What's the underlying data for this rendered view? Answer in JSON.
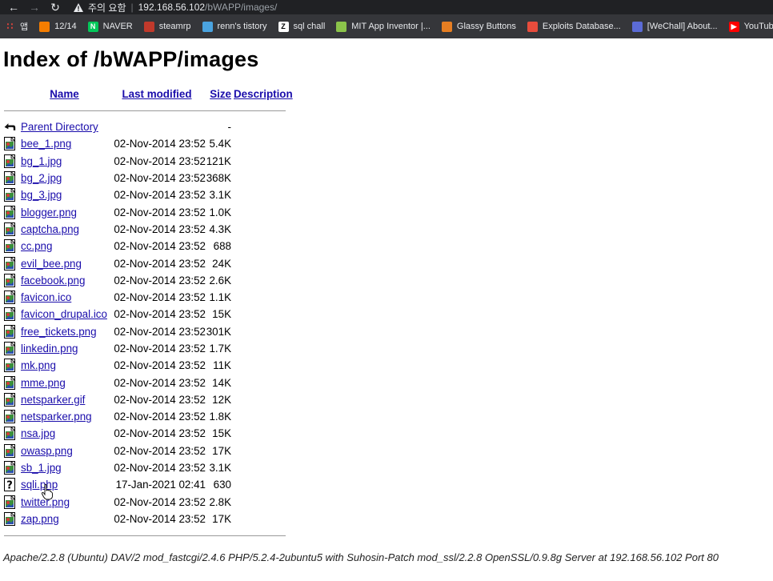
{
  "browser": {
    "security_label": "주의 요함",
    "url_host": "192.168.56.102",
    "url_path": "/bWAPP/images/",
    "bookmarks": [
      {
        "label": "앱",
        "icon": "apps-grid-icon",
        "color": "#e8453c"
      },
      {
        "label": "12/14",
        "icon": "blogger-icon",
        "color": "#f57d00"
      },
      {
        "label": "NAVER",
        "icon": "naver-icon",
        "color": "#03c75a"
      },
      {
        "label": "steamrp",
        "icon": "steamrp-icon",
        "color": "#c0392b"
      },
      {
        "label": "renn's tistory",
        "icon": "tistory-icon",
        "color": "#4aa3df"
      },
      {
        "label": "sql chall",
        "icon": "z-icon",
        "color": "#ffffff"
      },
      {
        "label": "MIT App Inventor |...",
        "icon": "mit-app-inventor-icon",
        "color": "#8bc34a"
      },
      {
        "label": "Glassy Buttons",
        "icon": "glassy-buttons-icon",
        "color": "#e67e22"
      },
      {
        "label": "Exploits Database...",
        "icon": "exploit-db-icon",
        "color": "#e74c3c"
      },
      {
        "label": "[WeChall] About...",
        "icon": "wechall-icon",
        "color": "#5b6bd6"
      },
      {
        "label": "YouTube",
        "icon": "youtube-icon",
        "color": "#ff0000"
      }
    ]
  },
  "page": {
    "title": "Index of /bWAPP/images",
    "columns": {
      "name": "Name",
      "last_modified": "Last modified",
      "size": "Size",
      "description": "Description"
    },
    "parent": {
      "name": "Parent Directory",
      "size": "-"
    },
    "files": [
      {
        "name": "bee_1.png",
        "date": "02-Nov-2014 23:52",
        "size": "5.4K",
        "icon": "image-file-icon"
      },
      {
        "name": "bg_1.jpg",
        "date": "02-Nov-2014 23:52",
        "size": "121K",
        "icon": "image-file-icon"
      },
      {
        "name": "bg_2.jpg",
        "date": "02-Nov-2014 23:52",
        "size": "368K",
        "icon": "image-file-icon"
      },
      {
        "name": "bg_3.jpg",
        "date": "02-Nov-2014 23:52",
        "size": "3.1K",
        "icon": "image-file-icon"
      },
      {
        "name": "blogger.png",
        "date": "02-Nov-2014 23:52",
        "size": "1.0K",
        "icon": "image-file-icon"
      },
      {
        "name": "captcha.png",
        "date": "02-Nov-2014 23:52",
        "size": "4.3K",
        "icon": "image-file-icon"
      },
      {
        "name": "cc.png",
        "date": "02-Nov-2014 23:52",
        "size": "688",
        "icon": "image-file-icon"
      },
      {
        "name": "evil_bee.png",
        "date": "02-Nov-2014 23:52",
        "size": "24K",
        "icon": "image-file-icon"
      },
      {
        "name": "facebook.png",
        "date": "02-Nov-2014 23:52",
        "size": "2.6K",
        "icon": "image-file-icon"
      },
      {
        "name": "favicon.ico",
        "date": "02-Nov-2014 23:52",
        "size": "1.1K",
        "icon": "image-file-icon"
      },
      {
        "name": "favicon_drupal.ico",
        "date": "02-Nov-2014 23:52",
        "size": "15K",
        "icon": "image-file-icon"
      },
      {
        "name": "free_tickets.png",
        "date": "02-Nov-2014 23:52",
        "size": "301K",
        "icon": "image-file-icon"
      },
      {
        "name": "linkedin.png",
        "date": "02-Nov-2014 23:52",
        "size": "1.7K",
        "icon": "image-file-icon"
      },
      {
        "name": "mk.png",
        "date": "02-Nov-2014 23:52",
        "size": "11K",
        "icon": "image-file-icon"
      },
      {
        "name": "mme.png",
        "date": "02-Nov-2014 23:52",
        "size": "14K",
        "icon": "image-file-icon"
      },
      {
        "name": "netsparker.gif",
        "date": "02-Nov-2014 23:52",
        "size": "12K",
        "icon": "image-file-icon"
      },
      {
        "name": "netsparker.png",
        "date": "02-Nov-2014 23:52",
        "size": "1.8K",
        "icon": "image-file-icon"
      },
      {
        "name": "nsa.jpg",
        "date": "02-Nov-2014 23:52",
        "size": "15K",
        "icon": "image-file-icon"
      },
      {
        "name": "owasp.png",
        "date": "02-Nov-2014 23:52",
        "size": "17K",
        "icon": "image-file-icon"
      },
      {
        "name": "sb_1.jpg",
        "date": "02-Nov-2014 23:52",
        "size": "3.1K",
        "icon": "image-file-icon"
      },
      {
        "name": "sqli.php",
        "date": "17-Jan-2021 02:41",
        "size": "630",
        "icon": "unknown-file-icon"
      },
      {
        "name": "twitter.png",
        "date": "02-Nov-2014 23:52",
        "size": "2.8K",
        "icon": "image-file-icon"
      },
      {
        "name": "zap.png",
        "date": "02-Nov-2014 23:52",
        "size": "17K",
        "icon": "image-file-icon"
      }
    ],
    "server_signature": "Apache/2.2.8 (Ubuntu) DAV/2 mod_fastcgi/2.4.6 PHP/5.2.4-2ubuntu5 with Suhosin-Patch mod_ssl/2.2.8 OpenSSL/0.9.8g Server at 192.168.56.102 Port 80"
  }
}
